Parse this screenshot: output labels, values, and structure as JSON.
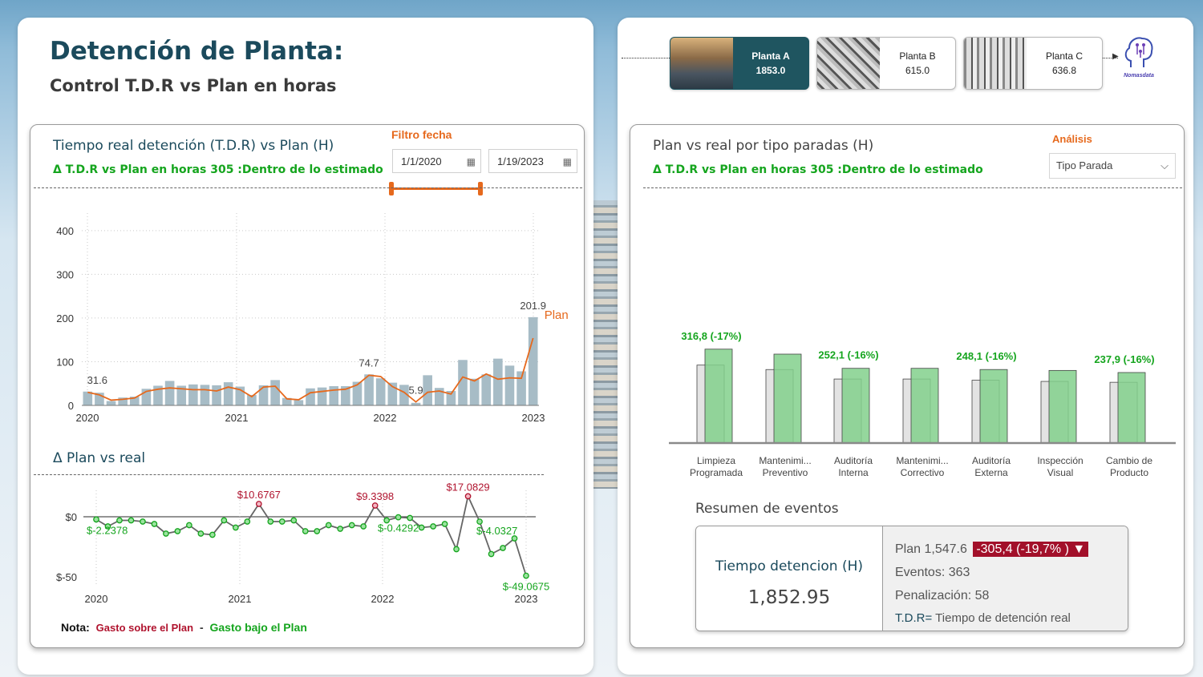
{
  "header": {
    "title": "Detención de Planta:",
    "subtitle": "Control T.D.R vs Plan en horas"
  },
  "left_card": {
    "title": "Tiempo real detención (T.D.R) vs Plan (H)",
    "delta_text": "Δ T.D.R vs Plan en horas 305 :Dentro de lo estimado",
    "filter_label": "Filtro fecha",
    "date_from": "1/1/2020",
    "date_to": "1/19/2023",
    "plan_label": "Plan",
    "delta_title": "Δ Plan vs real",
    "note_label": "Nota:",
    "note_over": "Gasto sobre el Plan",
    "note_sep": "-",
    "note_under": "Gasto bajo el Plan"
  },
  "plants": [
    {
      "name": "Planta A",
      "value": "1853.0",
      "active": true
    },
    {
      "name": "Planta B",
      "value": "615.0",
      "active": false
    },
    {
      "name": "Planta C",
      "value": "636.8",
      "active": false
    }
  ],
  "logo_text": "Nomasdata",
  "right_card": {
    "title": "Plan vs real por tipo paradas (H)",
    "delta_text": "Δ T.D.R vs Plan en horas 305 :Dentro de lo estimado",
    "analysis_label": "Análisis",
    "dropdown_value": "Tipo Parada"
  },
  "summary": {
    "section_title": "Resumen de eventos",
    "metric_label": "Tiempo detencion (H)",
    "metric_value": "1,852.95",
    "plan_text": "Plan 1,547.6",
    "plan_delta": "-305,4 (-19,7% ) ▼",
    "events": "Eventos: 363",
    "penalty": "Penalización: 58",
    "tdr_abbr": "T.D.R=",
    "tdr_def": " Tiempo de detención real"
  },
  "colors": {
    "bar_real": "#a7bcc6",
    "plan_line": "#e6691d",
    "green": "#15a51e",
    "red": "#b0132e",
    "bar_plan": "#82d08c",
    "bar_gray": "#e3e3e3",
    "teal": "#1f5560"
  },
  "chart_data": [
    {
      "type": "bar",
      "title": "Tiempo real detención (T.D.R) vs Plan (H)",
      "x_ticks": [
        "2020",
        "2021",
        "2022",
        "2023"
      ],
      "y_ticks": [
        0,
        100,
        200,
        300,
        400
      ],
      "ylim": [
        0,
        440
      ],
      "series": [
        {
          "name": "T.D.R",
          "type": "bar",
          "values": [
            31.6,
            29,
            10,
            18,
            20,
            38,
            45,
            56,
            45,
            48,
            47,
            46,
            53,
            43,
            24,
            46,
            58,
            17,
            12,
            39,
            41,
            44,
            44,
            54,
            71,
            62,
            52,
            47,
            5.9,
            69,
            40,
            33,
            104,
            61,
            71,
            107,
            91,
            78,
            201.9
          ]
        },
        {
          "name": "Plan",
          "type": "line",
          "values": [
            30,
            24,
            12,
            14,
            17,
            32,
            37,
            40,
            38,
            36,
            36,
            33,
            42,
            36,
            20,
            42,
            44,
            15,
            13,
            29,
            32,
            35,
            37,
            47,
            69,
            66,
            43,
            30,
            8,
            30,
            33,
            26,
            65,
            56,
            72,
            60,
            63,
            62,
            154
          ]
        }
      ],
      "data_labels": [
        {
          "index": 0,
          "text": "31.6"
        },
        {
          "index": 24,
          "text": "74.7"
        },
        {
          "index": 28,
          "text": "5.9"
        },
        {
          "index": 38,
          "text": "201.9"
        }
      ]
    },
    {
      "type": "line",
      "title": "Δ Plan vs real",
      "x_ticks": [
        "2020",
        "2021",
        "2022",
        "2023"
      ],
      "y_ticks": [
        "$0",
        "$-50"
      ],
      "ylim": [
        -55,
        15
      ],
      "values": [
        -2.2378,
        -8,
        -3,
        -3,
        -4,
        -6,
        -14,
        -12,
        -7,
        -14,
        -15,
        -3,
        -9,
        -4,
        10.6767,
        -4,
        -4,
        -3,
        -12,
        -12,
        -7,
        -10,
        -7,
        -8,
        9.3398,
        -3,
        -0.4292,
        -1,
        -9,
        -8,
        -6,
        -27,
        17.0829,
        -4.0327,
        -31,
        -26,
        -18,
        -49.0675
      ],
      "data_labels": [
        {
          "index": 0,
          "text": "$-2.2378"
        },
        {
          "index": 14,
          "text": "$10.6767"
        },
        {
          "index": 24,
          "text": "$9.3398"
        },
        {
          "index": 26,
          "text": "$-0.4292"
        },
        {
          "index": 32,
          "text": "$17.0829"
        },
        {
          "index": 33,
          "text": "$-4.0327"
        },
        {
          "index": 37,
          "text": "$-49.0675"
        }
      ]
    },
    {
      "type": "bar",
      "title": "Plan vs real por tipo paradas (H)",
      "categories": [
        "Limpieza Programada",
        "Mantenimi... Preventivo",
        "Auditoría Interna",
        "Mantenimi... Correctivo",
        "Auditoría Externa",
        "Inspección Visual",
        "Cambio de Producto"
      ],
      "category_lines": [
        [
          "Limpieza",
          "Programada"
        ],
        [
          "Mantenimi...",
          "Preventivo"
        ],
        [
          "Auditoría",
          "Interna"
        ],
        [
          "Mantenimi...",
          "Correctivo"
        ],
        [
          "Auditoría",
          "Externa"
        ],
        [
          "Inspección",
          "Visual"
        ],
        [
          "Cambio de",
          "Producto"
        ]
      ],
      "series": [
        {
          "name": "Plan",
          "values": [
            263,
            248,
            216,
            216,
            212,
            208,
            205
          ]
        },
        {
          "name": "Real",
          "values": [
            316.8,
            300,
            252.1,
            252.1,
            248.1,
            245,
            237.9
          ]
        }
      ],
      "data_labels": [
        {
          "index": 0,
          "text": "316,8 (-17%)"
        },
        {
          "index": 2,
          "text": "252,1 (-16%)"
        },
        {
          "index": 4,
          "text": "248,1 (-16%)"
        },
        {
          "index": 6,
          "text": "237,9 (-16%)"
        }
      ]
    }
  ]
}
